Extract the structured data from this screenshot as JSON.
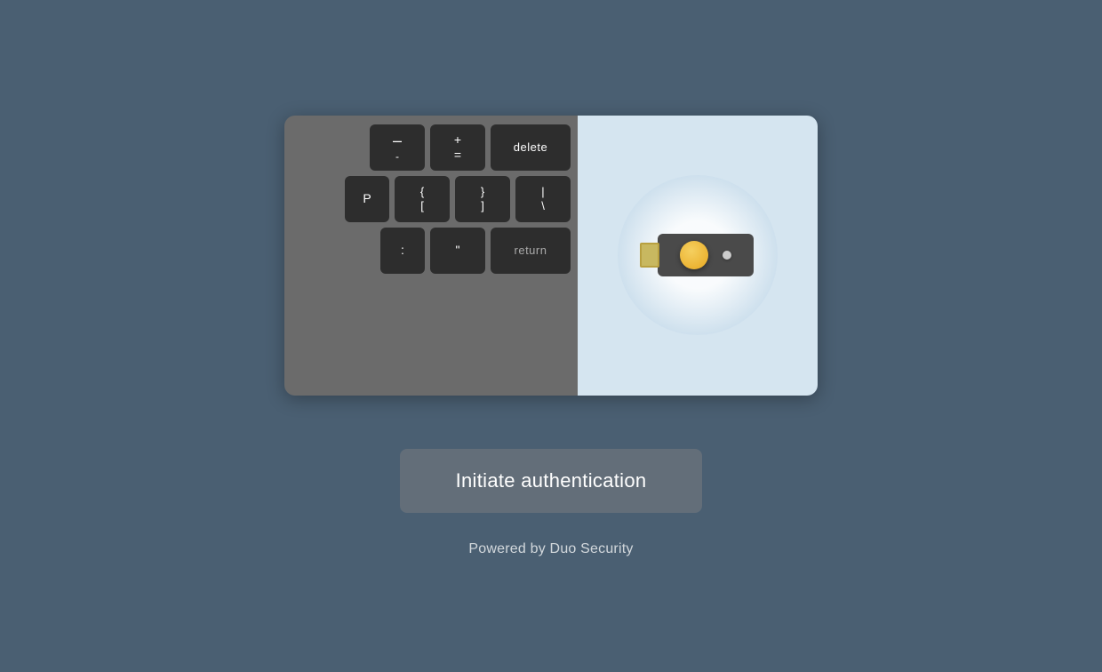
{
  "hero": {
    "keyboard": {
      "rows": [
        {
          "keys": [
            {
              "id": "minus",
              "top": "–",
              "bottom": "-"
            },
            {
              "id": "plus",
              "top": "+",
              "bottom": "="
            },
            {
              "id": "delete",
              "label": "delete"
            }
          ]
        },
        {
          "keys": [
            {
              "id": "p",
              "label": "P"
            },
            {
              "id": "brace-open",
              "top": "{",
              "bottom": "["
            },
            {
              "id": "brace-close",
              "top": "}",
              "bottom": "]"
            },
            {
              "id": "pipe",
              "top": "|",
              "bottom": "\\"
            }
          ]
        },
        {
          "keys": [
            {
              "id": "colon",
              "label": ":"
            },
            {
              "id": "quote",
              "label": "\""
            },
            {
              "id": "return",
              "label": "return"
            }
          ]
        }
      ]
    }
  },
  "button": {
    "label": "Initiate authentication"
  },
  "footer": {
    "text": "Powered by Duo Security"
  }
}
